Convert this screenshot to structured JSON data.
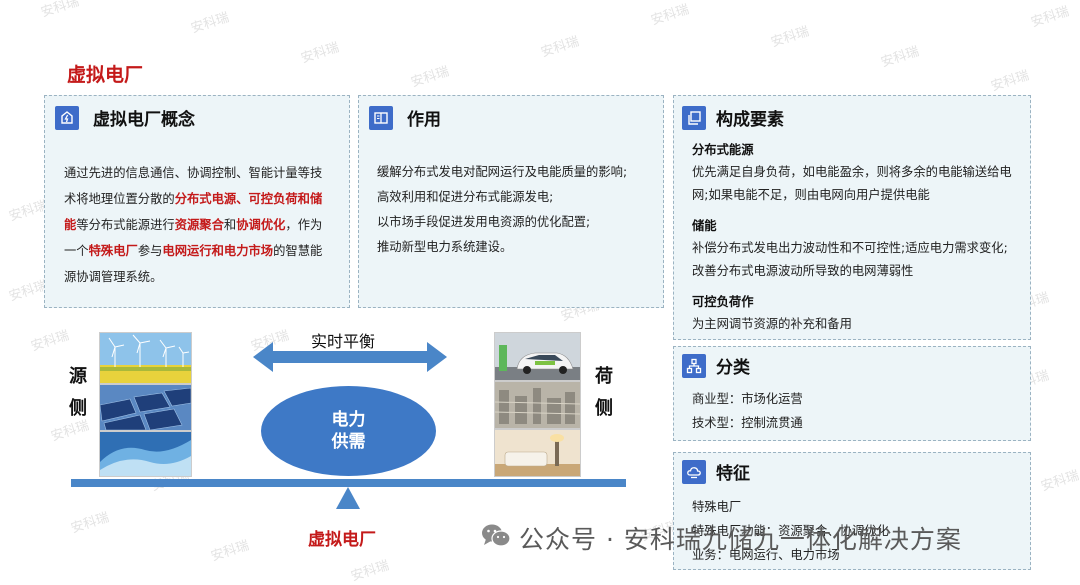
{
  "title": "虚拟电厂",
  "watermark": "安科瑞",
  "concept": {
    "title": "虚拟电厂概念",
    "segments": [
      {
        "t": "通过先进的信息通信、协调控制、智能计量等技术将地理位置分散的",
        "b": false
      },
      {
        "t": "分布式电源、可控负荷和储能",
        "b": true
      },
      {
        "t": "等分布式能源进行",
        "b": false
      },
      {
        "t": "资源聚合",
        "b": true
      },
      {
        "t": "和",
        "b": false
      },
      {
        "t": "协调优化",
        "b": true
      },
      {
        "t": "，作为一个",
        "b": false
      },
      {
        "t": "特殊电厂",
        "b": true
      },
      {
        "t": "参与",
        "b": false
      },
      {
        "t": "电网运行和电力市场",
        "b": true
      },
      {
        "t": "的智慧能源协调管理系统。",
        "b": false
      }
    ]
  },
  "effect": {
    "title": "作用",
    "items": [
      "缓解分布式发电对配网运行及电能质量的影响;",
      "高效利用和促进分布式能源发电;",
      "以市场手段促进发用电资源的优化配置;",
      "推动新型电力系统建设。"
    ]
  },
  "components": {
    "title": "构成要素",
    "sections": [
      {
        "head": "分布式能源",
        "text": "优先满足自身负荷，如电能盈余，则将多余的电能输送给电网;如果电能不足，则由电网向用户提供电能"
      },
      {
        "head": "储能",
        "text": "补偿分布式发电出力波动性和不可控性;适应电力需求变化;改善分布式电源波动所导致的电网薄弱性"
      },
      {
        "head": "可控负荷作",
        "text": "为主网调节资源的补充和备用"
      }
    ]
  },
  "classification": {
    "title": "分类",
    "items": [
      "商业型：市场化运营",
      "技术型：控制流贯通"
    ]
  },
  "features": {
    "title": "特征",
    "items": [
      "特殊电厂",
      "特殊电厂功能：资源聚合、协调优化",
      "业务：电网运行、电力市场"
    ]
  },
  "diagram": {
    "source_label": "源侧",
    "load_label": "荷侧",
    "balance_label": "实时平衡",
    "center_line1": "电力",
    "center_line2": "供需",
    "bottom_label": "虚拟电厂"
  },
  "footer": {
    "text": "公众号 · 安科瑞九储九一体化解决方案",
    "icon": "wechat-icon"
  },
  "colors": {
    "accent_red": "#c41a1a",
    "accent_blue": "#3e79c6",
    "card_bg": "#edf5f8"
  }
}
